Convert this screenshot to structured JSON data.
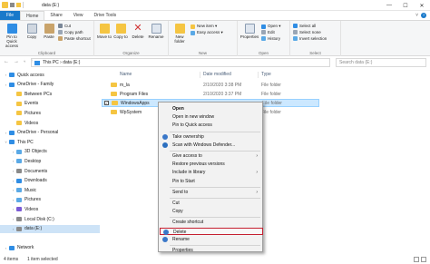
{
  "window": {
    "title": "data (E:)",
    "minimize": "—",
    "maximize": "☐",
    "close": "✕"
  },
  "tabs": {
    "file": "File",
    "home": "Home",
    "share": "Share",
    "view": "View",
    "drive_tools": "Drive Tools"
  },
  "ribbon": {
    "clipboard": {
      "label": "Clipboard",
      "pin": "Pin to Quick access",
      "copy": "Copy",
      "paste": "Paste",
      "cut": "Cut",
      "copy_path": "Copy path",
      "paste_shortcut": "Paste shortcut"
    },
    "organize": {
      "label": "Organize",
      "move_to": "Move to",
      "copy_to": "Copy to",
      "delete": "Delete",
      "rename": "Rename"
    },
    "new": {
      "label": "New",
      "new_folder": "New folder",
      "new_item": "New item ▾",
      "easy_access": "Easy access ▾"
    },
    "open": {
      "label": "Open",
      "properties": "Properties",
      "open": "Open ▾",
      "edit": "Edit",
      "history": "History"
    },
    "select": {
      "label": "Select",
      "select_all": "Select all",
      "select_none": "Select none",
      "invert": "Invert selection"
    }
  },
  "address": {
    "path": "This PC  ›  data (E:)",
    "search_placeholder": "Search data (E:)"
  },
  "nav": [
    {
      "label": "Quick access",
      "icon": "star-icon",
      "color": "#2f8de4",
      "chevron": "›"
    },
    {
      "label": "OneDrive - Family",
      "icon": "cloud-icon",
      "color": "#2f8de4",
      "chevron": "›"
    },
    {
      "label": "Between PCs",
      "icon": "folder-icon",
      "color": "#f5c542",
      "chevron": ""
    },
    {
      "label": "Events",
      "icon": "folder-icon",
      "color": "#f5c542",
      "chevron": ""
    },
    {
      "label": "Pictures",
      "icon": "folder-icon",
      "color": "#f5c542",
      "chevron": ""
    },
    {
      "label": "Videos",
      "icon": "folder-icon",
      "color": "#f5c542",
      "chevron": ""
    },
    {
      "label": "OneDrive - Personal",
      "icon": "cloud-icon",
      "color": "#2f8de4",
      "chevron": "›"
    },
    {
      "label": "This PC",
      "icon": "pc-icon",
      "color": "#2f8de4",
      "chevron": "˅"
    },
    {
      "label": "3D Objects",
      "icon": "folder-icon",
      "color": "#5aa9e6",
      "chevron": "›"
    },
    {
      "label": "Desktop",
      "icon": "folder-icon",
      "color": "#5aa9e6",
      "chevron": "›"
    },
    {
      "label": "Documents",
      "icon": "folder-icon",
      "color": "#8a8a8a",
      "chevron": "›"
    },
    {
      "label": "Downloads",
      "icon": "folder-icon",
      "color": "#2f8de4",
      "chevron": "›"
    },
    {
      "label": "Music",
      "icon": "folder-icon",
      "color": "#5aa9e6",
      "chevron": "›"
    },
    {
      "label": "Pictures",
      "icon": "folder-icon",
      "color": "#5aa9e6",
      "chevron": "›"
    },
    {
      "label": "Videos",
      "icon": "folder-icon",
      "color": "#7b5bd6",
      "chevron": "›"
    },
    {
      "label": "Local Disk (C:)",
      "icon": "drive-icon",
      "color": "#8a8a8a",
      "chevron": "›"
    },
    {
      "label": "data (E:)",
      "icon": "drive-icon",
      "color": "#8a8a8a",
      "chevron": "›"
    },
    {
      "label": "",
      "icon": "",
      "color": "#ffffff",
      "chevron": ""
    },
    {
      "label": "Network",
      "icon": "network-icon",
      "color": "#2f8de4",
      "chevron": "›"
    }
  ],
  "columns": {
    "name": "Name",
    "date": "Date modified",
    "type": "Type"
  },
  "files": [
    {
      "name": "m_la",
      "date": "2/10/2020 3:38 PM",
      "type": "File folder",
      "checked": ""
    },
    {
      "name": "Program Files",
      "date": "2/10/2020 3:37 PM",
      "type": "File folder",
      "checked": ""
    },
    {
      "name": "WindowsApps",
      "date": "",
      "type": "File folder",
      "checked": "✓"
    },
    {
      "name": "WpSystem",
      "date": "",
      "type": "File folder",
      "checked": ""
    }
  ],
  "context_menu": [
    {
      "label": "Open",
      "icon": "",
      "arrow": "",
      "bold": true
    },
    {
      "label": "Open in new window",
      "icon": "",
      "arrow": ""
    },
    {
      "label": "Pin to Quick access",
      "icon": "",
      "arrow": ""
    },
    {
      "label": "Take ownership",
      "icon": "shield-icon",
      "arrow": ""
    },
    {
      "label": "Scan with Windows Defender...",
      "icon": "defender-icon",
      "arrow": ""
    },
    {
      "label": "Give access to",
      "icon": "",
      "arrow": "›"
    },
    {
      "label": "Restore previous versions",
      "icon": "",
      "arrow": ""
    },
    {
      "label": "Include in library",
      "icon": "",
      "arrow": "›"
    },
    {
      "label": "Pin to Start",
      "icon": "",
      "arrow": ""
    },
    {
      "label": "Send to",
      "icon": "",
      "arrow": "›"
    },
    {
      "label": "Cut",
      "icon": "",
      "arrow": ""
    },
    {
      "label": "Copy",
      "icon": "",
      "arrow": ""
    },
    {
      "label": "Create shortcut",
      "icon": "",
      "arrow": ""
    },
    {
      "label": "Delete",
      "icon": "shield-icon",
      "arrow": ""
    },
    {
      "label": "Rename",
      "icon": "shield-icon",
      "arrow": ""
    },
    {
      "label": "Properties",
      "icon": "",
      "arrow": ""
    }
  ],
  "status": {
    "count": "4 items",
    "selected": "1 item selected"
  },
  "colors": {
    "accent": "#1979ca",
    "highlight_border": "#c51f30",
    "selection": "#cce8ff"
  }
}
